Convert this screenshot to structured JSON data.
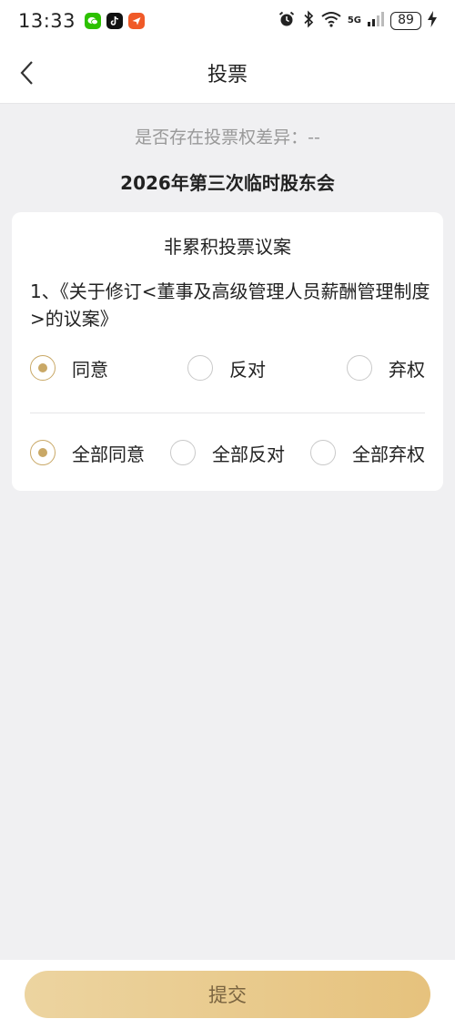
{
  "status_bar": {
    "time": "13:33",
    "network": "5G",
    "battery": "89"
  },
  "nav": {
    "title": "投票"
  },
  "vote_diff": {
    "text": "是否存在投票权差异：--"
  },
  "meeting": {
    "title": "2026年第三次临时股东会"
  },
  "card": {
    "heading": "非累积投票议案",
    "proposal": "1、《关于修订<董事及高级管理人员薪酬管理制度>的议案》",
    "options": [
      {
        "label": "同意",
        "selected": true
      },
      {
        "label": "反对",
        "selected": false
      },
      {
        "label": "弃权",
        "selected": false
      }
    ],
    "bulk_options": [
      {
        "label": "全部同意",
        "selected": true
      },
      {
        "label": "全部反对",
        "selected": false
      },
      {
        "label": "全部弃权",
        "selected": false
      }
    ]
  },
  "submit": {
    "label": "提交"
  },
  "colors": {
    "accent": "#c9a866",
    "button_start": "#ecd4a0",
    "button_end": "#e6c27d",
    "background": "#f0f0f2"
  }
}
